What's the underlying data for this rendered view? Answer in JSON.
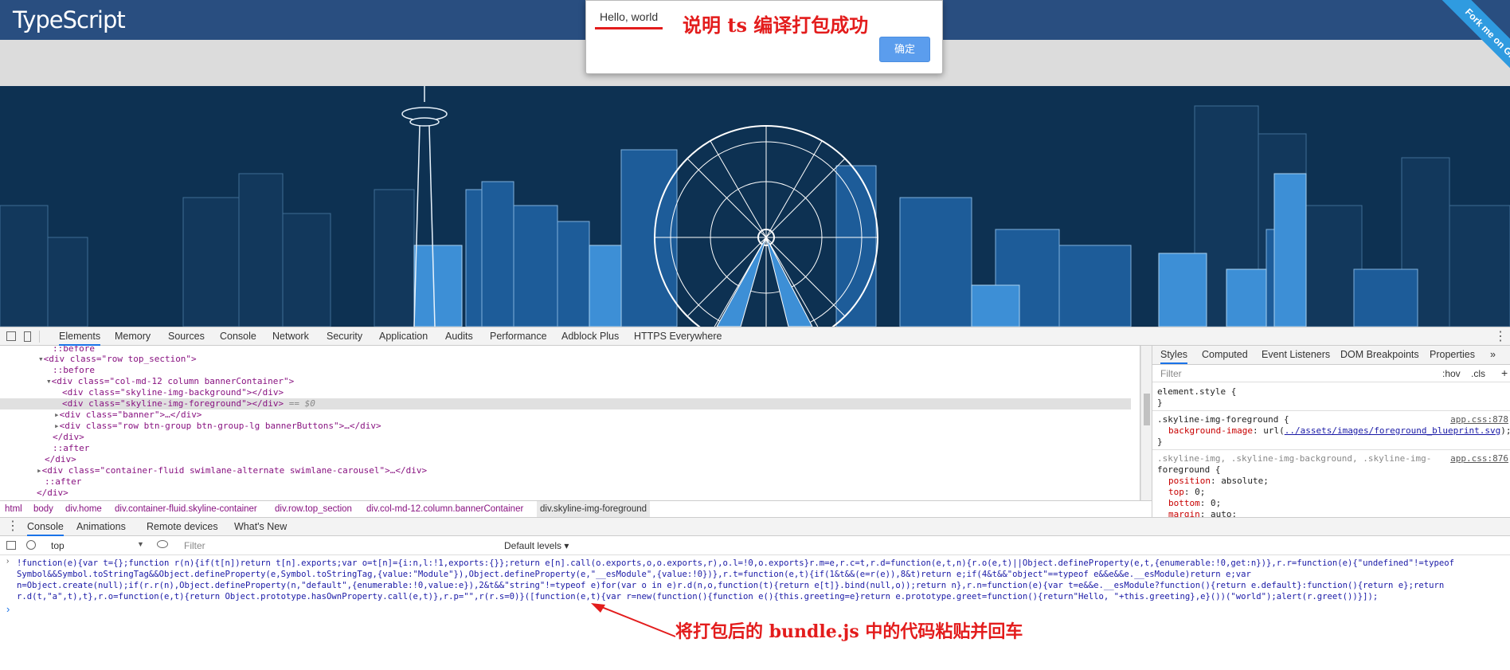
{
  "site": {
    "logo": "TypeScript",
    "ribbon": "Fork me on GitHub"
  },
  "alert": {
    "message": "Hello, world",
    "ok_label": "确定"
  },
  "annotations": {
    "top_note": "说明 ts 编译打包成功",
    "bottom_note": "将打包后的 bundle.js 中的代码粘贴并回车",
    "color": "#e31c1c"
  },
  "devtools": {
    "tabs": [
      "Elements",
      "Memory",
      "Sources",
      "Console",
      "Network",
      "Security",
      "Application",
      "Audits",
      "Performance",
      "Adblock Plus",
      "HTTPS Everywhere"
    ],
    "selected_tab": "Elements",
    "elements": [
      {
        "text": "::before"
      },
      {
        "text": "<div class=\"row top_section\">"
      },
      {
        "text": "::before"
      },
      {
        "text": "<div class=\"col-md-12 column bannerContainer\">"
      },
      {
        "text": "<div class=\"skyline-img-background\"></div>"
      },
      {
        "text": "<div class=\"skyline-img-foreground\"></div>",
        "suffix": "== $0"
      },
      {
        "text": "<div class=\"banner\">…</div>"
      },
      {
        "text": "<div class=\"row btn-group btn-group-lg bannerButtons\">…</div>"
      },
      {
        "text": "</div>"
      },
      {
        "text": "::after"
      },
      {
        "text": "</div>"
      },
      {
        "text": "<div class=\"container-fluid swimlane-alternate swimlane-carousel\">…</div>"
      },
      {
        "text": "::after"
      },
      {
        "text": "</div>"
      }
    ],
    "breadcrumbs": [
      "html",
      "body",
      "div.home",
      "div.container-fluid.skyline-container",
      "div.row.top_section",
      "div.col-md-12.column.bannerContainer",
      "div.skyline-img-foreground"
    ],
    "styles": {
      "tabs": [
        "Styles",
        "Computed",
        "Event Listeners",
        "DOM Breakpoints",
        "Properties",
        "»"
      ],
      "filter_placeholder": "Filter",
      "hov": ":hov",
      "cls": ".cls",
      "plus": "+",
      "rules": {
        "element_style": "element.style {",
        "element_close": "}",
        "r1_selector": ".skyline-img-foreground {",
        "r1_source": "app.css:878",
        "r1_prop": "background-image",
        "r1_value_pre": "url(",
        "r1_link": "../assets/images/foreground_blueprint.svg",
        "r1_value_post": ");",
        "r1_close": "}",
        "r2_selector_1": ".skyline-img, .skyline-img-background, .skyline-img-",
        "r2_selector_2": "foreground {",
        "r2_source": "app.css:876",
        "r2_props": [
          {
            "name": "position",
            "value": "absolute;"
          },
          {
            "name": "top",
            "value": "0;"
          },
          {
            "name": "bottom",
            "value": "0;"
          },
          {
            "name": "margin",
            "value": "auto;"
          }
        ]
      }
    },
    "drawer_tabs": [
      "Console",
      "Animations",
      "Remote devices",
      "What's New"
    ],
    "console_context": "top",
    "console_filter": "Filter",
    "console_levels": "Default levels ▾",
    "console_code": [
      "!function(e){var t={};function r(n){if(t[n])return t[n].exports;var o=t[n]={i:n,l:!1,exports:{}};return e[n].call(o.exports,o,o.exports,r),o.l=!0,o.exports}r.m=e,r.c=t,r.d=function(e,t,n){r.o(e,t)||Object.defineProperty(e,t,{enumerable:!0,get:n})},r.r=function(e){\"undefined\"!=typeof",
      "Symbol&&Symbol.toStringTag&&Object.defineProperty(e,Symbol.toStringTag,{value:\"Module\"}),Object.defineProperty(e,\"__esModule\",{value:!0})},r.t=function(e,t){if(1&t&&(e=r(e)),8&t)return e;if(4&t&&\"object\"==typeof e&&e&&e.__esModule)return e;var",
      "n=Object.create(null);if(r.r(n),Object.defineProperty(n,\"default\",{enumerable:!0,value:e}),2&t&&\"string\"!=typeof e)for(var o in e)r.d(n,o,function(t){return e[t]}.bind(null,o));return n},r.n=function(e){var t=e&&e.__esModule?function(){return e.default}:function(){return e};return",
      "r.d(t,\"a\",t),t},r.o=function(e,t){return Object.prototype.hasOwnProperty.call(e,t)},r.p=\"\",r(r.s=0)}([function(e,t){var r=new(function(){function e(){this.greeting=e}return e.prototype.greet=function(){return\"Hello, \"+this.greeting},e}())(\"world\");alert(r.greet())}]);"
    ],
    "prompt": "›"
  }
}
